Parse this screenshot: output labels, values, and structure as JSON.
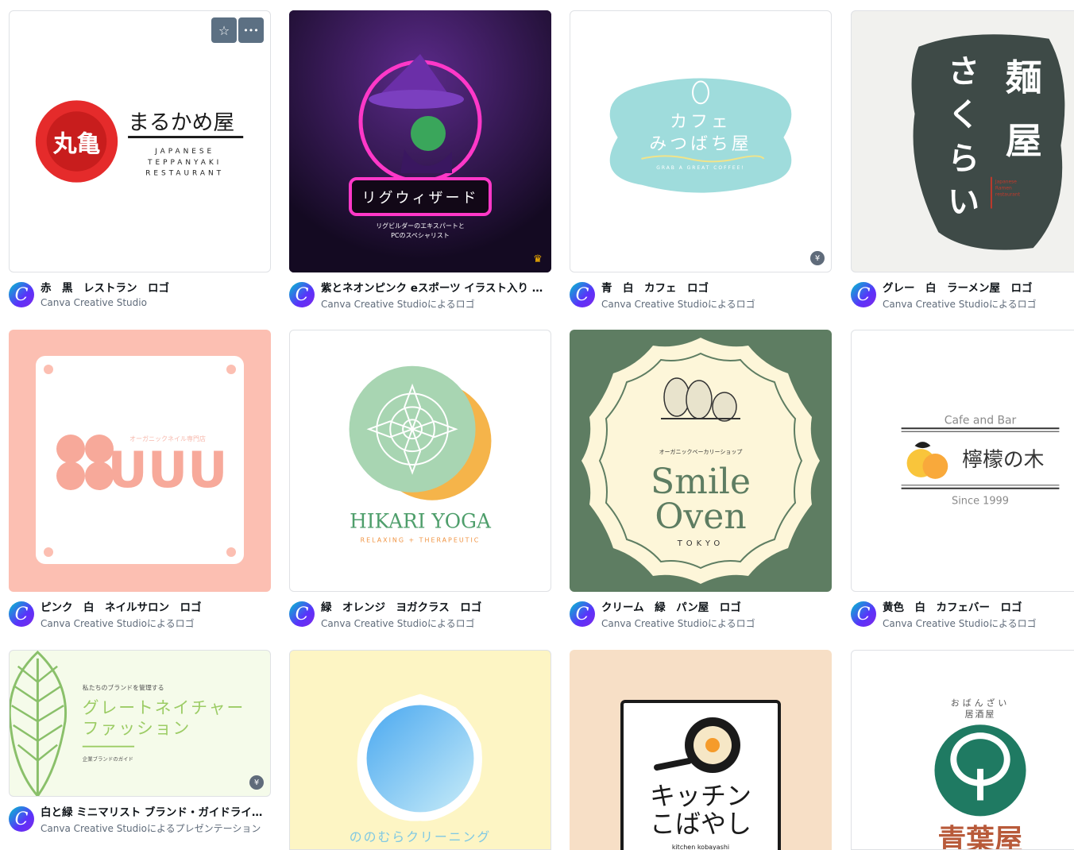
{
  "cards": [
    {
      "title": "赤　黒　レストラン　ロゴ",
      "subtitle": "Canva Creative Studio",
      "thumb": {
        "kanji": "丸亀",
        "main": "まるかめ屋",
        "l1": "JAPANESE",
        "l2": "TEPPANYAKI",
        "l3": "RESTAURANT"
      },
      "badge": ""
    },
    {
      "title": "紫とネオンピンク eスポーツ イラスト入り ゲーミング ロゴ",
      "subtitle": "Canva Creative Studioによるロゴ",
      "thumb": {
        "main": "リグウィザード",
        "l1": "リグビルダーのエキスパートと",
        "l2": "PCのスペシャリスト"
      },
      "badge": "♛"
    },
    {
      "title": "青　白　カフェ　ロゴ",
      "subtitle": "Canva Creative Studioによるロゴ",
      "thumb": {
        "l1": "カフェ",
        "l2": "みつばち屋",
        "l3": "GRAB A GREAT COFFEE!"
      },
      "badge": "¥"
    },
    {
      "title": "グレー　白　ラーメン屋　ロゴ",
      "subtitle": "Canva Creative Studioによるロゴ",
      "thumb": {
        "c1": "麺",
        "c2": "屋",
        "c3": "さ",
        "c4": "く",
        "c5": "ら",
        "c6": "い",
        "l1": "Japanese",
        "l2": "Ramen",
        "l3": "restaurant"
      },
      "badge": ""
    },
    {
      "title": "ピンク　白　ネイルサロン　ロゴ",
      "subtitle": "Canva Creative Studioによるロゴ",
      "thumb": {
        "main": "UUU",
        "l1": "オーガニックネイル専門店"
      },
      "badge": ""
    },
    {
      "title": "緑　オレンジ　ヨガクラス　ロゴ",
      "subtitle": "Canva Creative Studioによるロゴ",
      "thumb": {
        "main": "HIKARI YOGA",
        "l1": "RELAXING + THERAPEUTIC"
      },
      "badge": ""
    },
    {
      "title": "クリーム　緑　パン屋　ロゴ",
      "subtitle": "Canva Creative Studioによるロゴ",
      "thumb": {
        "l1": "オーガニックベーカリーショップ",
        "l2": "Smile",
        "l3": "Oven",
        "l4": "TOKYO"
      },
      "badge": ""
    },
    {
      "title": "黄色　白　カフェバー　ロゴ",
      "subtitle": "Canva Creative Studioによるロゴ",
      "thumb": {
        "l1": "Cafe and Bar",
        "main": "檸檬の木",
        "l2": "Since 1999"
      },
      "badge": ""
    },
    {
      "title": "白と緑 ミニマリスト ブランド・ガイドライン プレゼンテーション",
      "subtitle": "Canva Creative Studioによるプレゼンテーション",
      "thumb": {
        "l1": "私たちのブランドを管理する",
        "l2": "グレートネイチャー",
        "l3": "ファッション",
        "l4": "企業ブランドのガイド"
      },
      "badge": "¥"
    },
    {
      "title": "",
      "subtitle": "",
      "thumb": {
        "main": "ののむらクリーニング"
      },
      "badge": ""
    },
    {
      "title": "",
      "subtitle": "",
      "thumb": {
        "l1": "キッチン",
        "l2": "こばやし",
        "l3": "kitchen kobayashi"
      },
      "badge": ""
    },
    {
      "title": "",
      "subtitle": "",
      "thumb": {
        "l1": "おばんざい",
        "l2": "居酒屋",
        "main": "青葉屋"
      },
      "badge": ""
    }
  ],
  "hover_tools": {
    "star": "☆",
    "more": "•••"
  },
  "avatar_letter": "C",
  "colors": {
    "accent": "#7d2ae8",
    "subtitle": "#5f6b7a"
  }
}
